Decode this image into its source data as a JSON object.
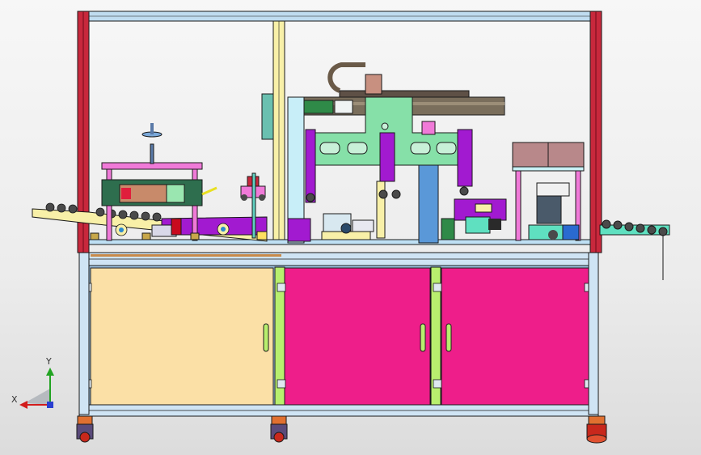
{
  "viewport": {
    "background": "#ececec",
    "view_triad": {
      "x_label": "X",
      "y_label": "Y",
      "x_color": "#d21c1c",
      "y_color": "#22a322",
      "z_color": "#2a3fd0"
    }
  },
  "colors": {
    "frame_blue": "#7fb6e0",
    "frame_red": "#c8283c",
    "frame_green": "#b8ef6e",
    "door_yellow": "#fbe0a6",
    "door_magenta": "#ee1e8a",
    "panel_green": "#86e0a8",
    "purple": "#a21ad0",
    "pink": "#f07ad8",
    "copper": "#c88a6a",
    "gray": "#8a96a8",
    "cream": "#f8f0a8",
    "teal": "#5fe0c0",
    "rail": "#7a6e5c"
  }
}
